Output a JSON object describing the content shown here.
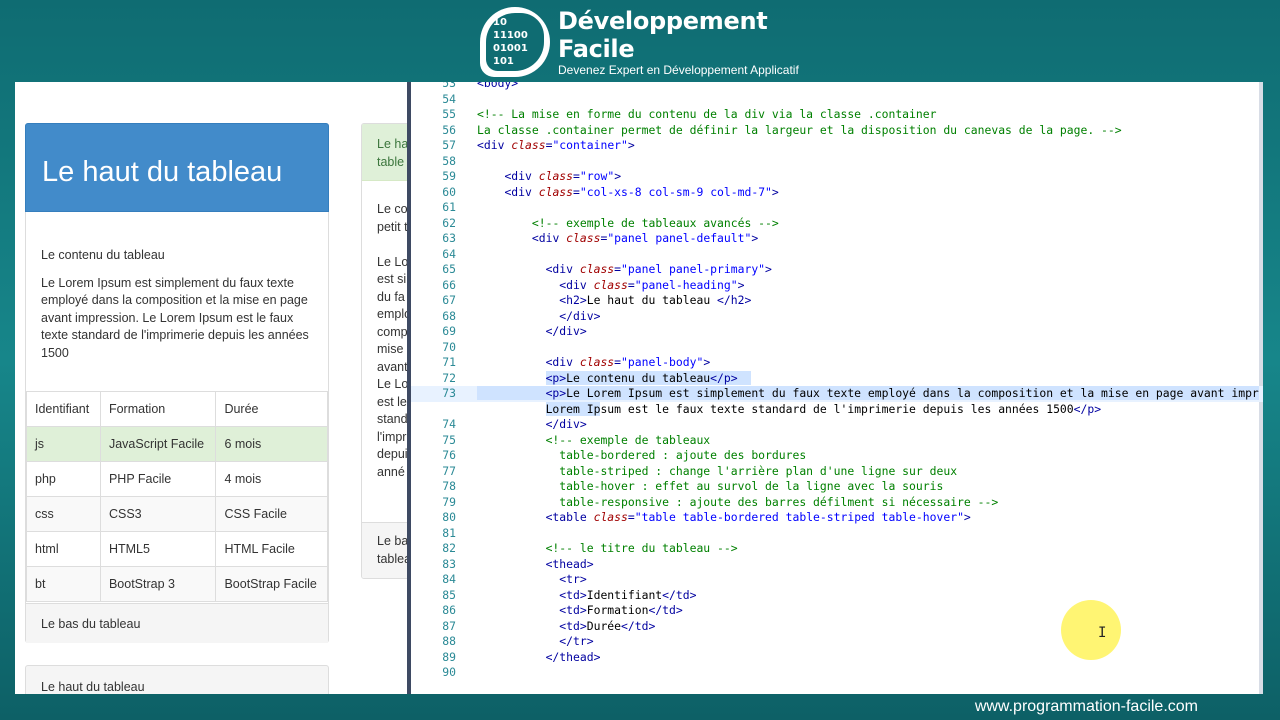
{
  "brand": {
    "logo_digits": [
      "10",
      "11100",
      "01001",
      "101"
    ],
    "title": "Développement Facile",
    "subtitle": "Devenez Expert en Développement Applicatif"
  },
  "preview": {
    "panel_title": "Le haut du tableau",
    "content_title": "Le contenu du tableau",
    "lorem": "Le Lorem Ipsum est simplement du faux texte employé dans la composition et la mise en page avant impression. Le Lorem Ipsum est le faux texte standard de l'imprimerie depuis les années 1500",
    "table": {
      "headers": [
        "Identifiant",
        "Formation",
        "Durée"
      ],
      "rows": [
        [
          "js",
          "JavaScript Facile",
          "6 mois"
        ],
        [
          "php",
          "PHP Facile",
          "4 mois"
        ],
        [
          "css",
          "CSS3",
          "CSS Facile"
        ],
        [
          "html",
          "HTML5",
          "HTML Facile"
        ],
        [
          "bt",
          "BootStrap 3",
          "BootStrap Facile"
        ]
      ]
    },
    "footer": "Le bas du tableau",
    "panel3_heading": "Le haut du tableau",
    "panel2_heading": [
      "Le ha",
      "table"
    ],
    "panel2_lines": [
      "Le co",
      "petit t",
      "",
      "Le Lo",
      "est si",
      "du fa",
      "emplo",
      "comp",
      "mise",
      "avant",
      "Le Lo",
      "est le",
      "standa",
      "l'impr",
      "depui",
      "anné"
    ],
    "panel2_footer": [
      "Le ba",
      "tablea"
    ]
  },
  "editor": {
    "lines": [
      {
        "n": "53",
        "html": "<span class='c-tag'>&lt;body&gt;</span>"
      },
      {
        "n": "54",
        "html": ""
      },
      {
        "n": "55",
        "html": "<span class='c-com'>&lt;!-- La mise en forme du contenu de la div via la classe .container</span>"
      },
      {
        "n": "56",
        "html": "<span class='c-com'>La classe .container permet de définir la largeur et la disposition du canevas de la page. --&gt;</span>"
      },
      {
        "n": "57",
        "html": "<span class='c-tag'>&lt;div </span><span class='c-attr'>class</span><span class='c-tag'>=</span><span class='c-val'>\"container\"</span><span class='c-tag'>&gt;</span>"
      },
      {
        "n": "58",
        "html": ""
      },
      {
        "n": "59",
        "html": "    <span class='c-tag'>&lt;div </span><span class='c-attr'>class</span><span class='c-tag'>=</span><span class='c-val'>\"row\"</span><span class='c-tag'>&gt;</span>"
      },
      {
        "n": "60",
        "html": "    <span class='c-tag'>&lt;div </span><span class='c-attr'>class</span><span class='c-tag'>=</span><span class='c-val'>\"col-xs-8 col-sm-9 col-md-7\"</span><span class='c-tag'>&gt;</span>"
      },
      {
        "n": "61",
        "html": ""
      },
      {
        "n": "62",
        "html": "        <span class='c-com'>&lt;!-- exemple de tableaux avancés --&gt;</span>"
      },
      {
        "n": "63",
        "html": "        <span class='c-tag'>&lt;div </span><span class='c-attr'>class</span><span class='c-tag'>=</span><span class='c-val'>\"panel panel-default\"</span><span class='c-tag'>&gt;</span>"
      },
      {
        "n": "64",
        "html": ""
      },
      {
        "n": "65",
        "html": "          <span class='c-tag'>&lt;div </span><span class='c-attr'>class</span><span class='c-tag'>=</span><span class='c-val'>\"panel panel-primary\"</span><span class='c-tag'>&gt;</span>"
      },
      {
        "n": "66",
        "html": "            <span class='c-tag'>&lt;div </span><span class='c-attr'>class</span><span class='c-tag'>=</span><span class='c-val'>\"panel-heading\"</span><span class='c-tag'>&gt;</span>"
      },
      {
        "n": "67",
        "html": "            <span class='c-tag'>&lt;h2&gt;</span>Le haut du tableau <span class='c-tag'>&lt;/h2&gt;</span>"
      },
      {
        "n": "68",
        "html": "            <span class='c-tag'>&lt;/div&gt;</span>"
      },
      {
        "n": "69",
        "html": "          <span class='c-tag'>&lt;/div&gt;</span>"
      },
      {
        "n": "70",
        "html": ""
      },
      {
        "n": "71",
        "html": "          <span class='c-tag'>&lt;div </span><span class='c-attr'>class</span><span class='c-tag'>=</span><span class='c-val'>\"panel-body\"</span><span class='c-tag'>&gt;</span>"
      },
      {
        "n": "72",
        "html": "          <span class='sel'><span class='c-tag'>&lt;p&gt;</span>Le contenu du tableau<span class='c-tag'>&lt;/p&gt;</span>  </span>"
      },
      {
        "n": "73",
        "html": "<span class='sel'>          <span class='c-tag'>&lt;p&gt;</span>Le Lorem Ipsum est simplement du faux texte employé dans la composition et la mise en page avant impr</span>",
        "cur": true
      },
      {
        "n": "",
        "html": "          <span class='sel'>Lorem Ip</span>sum est le faux texte standard de l'imprimerie depuis les années 1500<span class='c-tag'>&lt;/p&gt;</span>"
      },
      {
        "n": "74",
        "html": "          <span class='c-tag'>&lt;/div&gt;</span>"
      },
      {
        "n": "75",
        "html": "          <span class='c-com'>&lt;!-- exemple de tableaux</span>"
      },
      {
        "n": "76",
        "html": "            <span class='c-com'>table-bordered : ajoute des bordures</span>"
      },
      {
        "n": "77",
        "html": "            <span class='c-com'>table-striped : change l'arrière plan d'une ligne sur deux</span>"
      },
      {
        "n": "78",
        "html": "            <span class='c-com'>table-hover : effet au survol de la ligne avec la souris</span>"
      },
      {
        "n": "79",
        "html": "            <span class='c-com'>table-responsive : ajoute des barres défilment si nécessaire --&gt;</span>"
      },
      {
        "n": "80",
        "html": "          <span class='c-tag'>&lt;table </span><span class='c-attr'>class</span><span class='c-tag'>=</span><span class='c-val'>\"table table-bordered table-striped table-hover\"</span><span class='c-tag'>&gt;</span>"
      },
      {
        "n": "81",
        "html": ""
      },
      {
        "n": "82",
        "html": "          <span class='c-com'>&lt;!-- le titre du tableau --&gt;</span>"
      },
      {
        "n": "83",
        "html": "          <span class='c-tag'>&lt;thead&gt;</span>"
      },
      {
        "n": "84",
        "html": "            <span class='c-tag'>&lt;tr&gt;</span>"
      },
      {
        "n": "85",
        "html": "            <span class='c-tag'>&lt;td&gt;</span>Identifiant<span class='c-tag'>&lt;/td&gt;</span>"
      },
      {
        "n": "86",
        "html": "            <span class='c-tag'>&lt;td&gt;</span>Formation<span class='c-tag'>&lt;/td&gt;</span>"
      },
      {
        "n": "87",
        "html": "            <span class='c-tag'>&lt;td&gt;</span>Durée<span class='c-tag'>&lt;/td&gt;</span>"
      },
      {
        "n": "88",
        "html": "            <span class='c-tag'>&lt;/tr&gt;</span>"
      },
      {
        "n": "89",
        "html": "          <span class='c-tag'>&lt;/thead&gt;</span>"
      },
      {
        "n": "90",
        "html": ""
      }
    ]
  },
  "footer_url": "www.programmation-facile.com"
}
